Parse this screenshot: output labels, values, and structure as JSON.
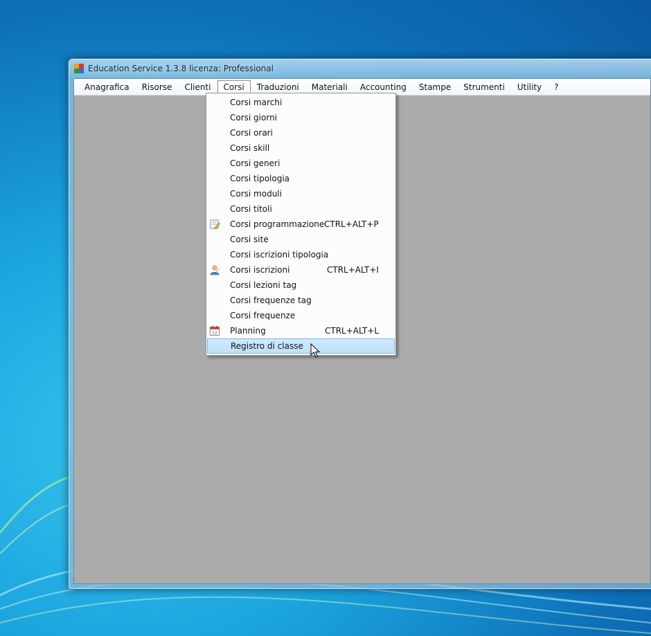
{
  "window": {
    "title": "Education Service 1.3.8 licenza: Professional"
  },
  "menubar": {
    "items": [
      {
        "label": "Anagrafica"
      },
      {
        "label": "Risorse"
      },
      {
        "label": "Clienti"
      },
      {
        "label": "Corsi",
        "open": true
      },
      {
        "label": "Traduzioni"
      },
      {
        "label": "Materiali"
      },
      {
        "label": "Accounting"
      },
      {
        "label": "Stampe"
      },
      {
        "label": "Strumenti"
      },
      {
        "label": "Utility"
      },
      {
        "label": "?"
      }
    ]
  },
  "corsi_menu": {
    "items": [
      {
        "label": "Corsi marchi",
        "shortcut": ""
      },
      {
        "label": "Corsi giorni",
        "shortcut": ""
      },
      {
        "label": "Corsi orari",
        "shortcut": ""
      },
      {
        "label": "Corsi skill",
        "shortcut": ""
      },
      {
        "label": "Corsi generi",
        "shortcut": ""
      },
      {
        "label": "Corsi tipologia",
        "shortcut": ""
      },
      {
        "label": "Corsi moduli",
        "shortcut": ""
      },
      {
        "label": "Corsi titoli",
        "shortcut": ""
      },
      {
        "label": "Corsi programmazione",
        "shortcut": "CTRL+ALT+P",
        "icon": "edit-document-icon"
      },
      {
        "label": "Corsi site",
        "shortcut": ""
      },
      {
        "label": "Corsi iscrizioni tipologia",
        "shortcut": ""
      },
      {
        "label": "Corsi iscrizioni",
        "shortcut": "CTRL+ALT+I",
        "icon": "user-icon"
      },
      {
        "label": "Corsi lezioni tag",
        "shortcut": ""
      },
      {
        "label": "Corsi frequenze tag",
        "shortcut": ""
      },
      {
        "label": "Corsi frequenze",
        "shortcut": ""
      },
      {
        "label": "Planning",
        "shortcut": "CTRL+ALT+L",
        "icon": "calendar-icon"
      },
      {
        "label": "Registro di classe",
        "shortcut": "",
        "hover": true
      }
    ]
  },
  "colors": {
    "mdi_background": "#ababab",
    "menu_hover": "#c4e3f9",
    "desktop": "#1ba2dd"
  }
}
